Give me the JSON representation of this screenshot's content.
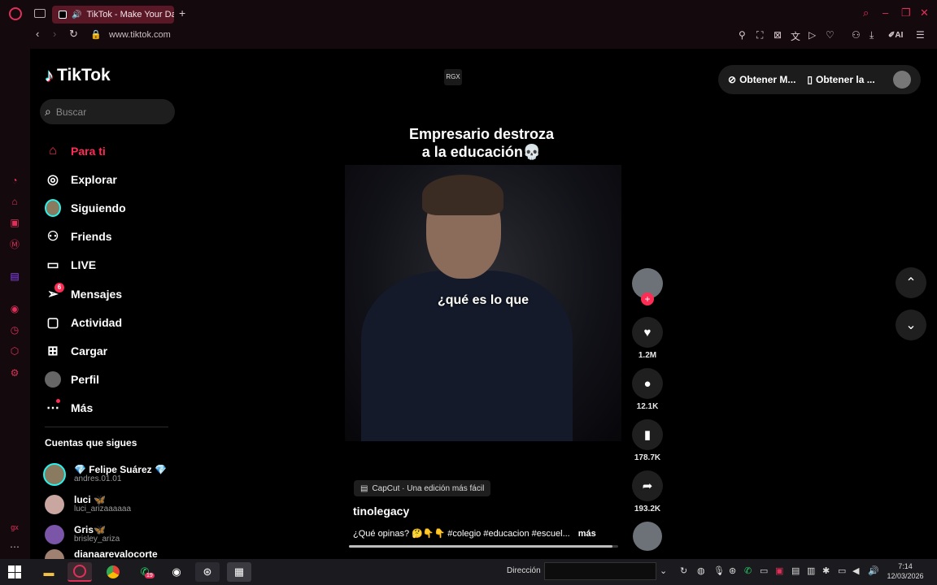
{
  "browser": {
    "tab_title": "TikTok - Make Your Da",
    "new_tab": "+",
    "url": "www.tiktok.com",
    "ai_label": "AI",
    "icons": [
      "opera-gx-logo",
      "workspace-icon",
      "minimize-icon",
      "restore-icon",
      "close-icon",
      "search-icon"
    ]
  },
  "tiktok": {
    "logo_text": "TikTok",
    "search_placeholder": "Buscar",
    "nav": [
      {
        "label": "Para ti",
        "icon": "home-icon",
        "active": true
      },
      {
        "label": "Explorar",
        "icon": "compass-icon"
      },
      {
        "label": "Siguiendo",
        "icon": "following-avatar"
      },
      {
        "label": "Friends",
        "icon": "friends-icon"
      },
      {
        "label": "LIVE",
        "icon": "live-icon"
      },
      {
        "label": "Mensajes",
        "icon": "messages-icon",
        "badge": "6"
      },
      {
        "label": "Actividad",
        "icon": "activity-icon"
      },
      {
        "label": "Cargar",
        "icon": "upload-icon"
      },
      {
        "label": "Perfil",
        "icon": "profile-avatar"
      },
      {
        "label": "Más",
        "icon": "more-icon"
      }
    ],
    "following_title": "Cuentas que sigues",
    "following": [
      {
        "name": "💎 Felipe Suárez 💎",
        "user": "andres.01.01"
      },
      {
        "name": "luci 🦋",
        "user": "luci_arizaaaaaa"
      },
      {
        "name": "Gris🦋",
        "user": "brisley_ariza"
      },
      {
        "name": "dianaarevalocorte",
        "user": ""
      }
    ],
    "rgx_badge": "RGX",
    "top_actions": {
      "get_app": "Obtener M...",
      "get_desktop": "Obtener la ..."
    },
    "video": {
      "caption_line1": "Empresario destroza",
      "caption_line2": "a la educación💀",
      "subtitle": "¿qué es lo que",
      "capcut": "CapCut · Una edición más fácil",
      "author": "tinolegacy",
      "description": "¿Qué opinas? 🤔👇👇 #colegio #educacion #escuel...",
      "more": "más",
      "progress": 0.98
    },
    "actions": [
      {
        "icon": "heart-icon",
        "count": "1.2M"
      },
      {
        "icon": "comment-icon",
        "count": "12.1K"
      },
      {
        "icon": "bookmark-icon",
        "count": "178.7K"
      },
      {
        "icon": "share-icon",
        "count": "193.2K"
      }
    ]
  },
  "taskbar": {
    "direction_label": "Dirección",
    "time": "7:14",
    "date": "12/03/2026",
    "notification_count": "19"
  }
}
